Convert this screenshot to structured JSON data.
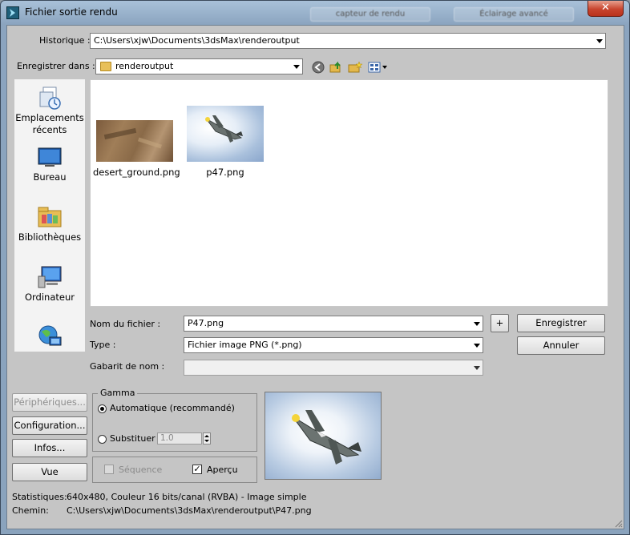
{
  "window": {
    "title": "Fichier sortie rendu",
    "close_glyph": "✕",
    "background_tabs": [
      "capteur de rendu",
      "Éclairage avancé"
    ]
  },
  "historique": {
    "label": "Historique :",
    "value": "C:\\Users\\xjw\\Documents\\3dsMax\\renderoutput"
  },
  "save_in": {
    "label": "Enregistrer dans :",
    "value": "renderoutput",
    "tools": [
      "back-icon",
      "up-folder-icon",
      "new-folder-icon",
      "view-menu-icon"
    ]
  },
  "places": [
    {
      "label": "Emplacements récents",
      "icon": "recent-places-icon"
    },
    {
      "label": "Bureau",
      "icon": "desktop-icon"
    },
    {
      "label": "Bibliothèques",
      "icon": "libraries-icon"
    },
    {
      "label": "Ordinateur",
      "icon": "computer-icon"
    },
    {
      "label": "",
      "icon": "network-icon"
    }
  ],
  "files": [
    {
      "name": "desert_ground.png"
    },
    {
      "name": "p47.png"
    }
  ],
  "filename": {
    "label": "Nom du fichier :",
    "value": "P47.png"
  },
  "type": {
    "label": "Type :",
    "value": "Fichier image PNG (*.png)"
  },
  "gabarit": {
    "label": "Gabarit de nom :",
    "value": ""
  },
  "buttons": {
    "plus": "+",
    "save": "Enregistrer",
    "cancel": "Annuler",
    "devices": "Périphériques...",
    "setup": "Configuration...",
    "info": "Infos...",
    "view": "Vue"
  },
  "gamma": {
    "title": "Gamma",
    "auto_label": "Automatique (recommandé)",
    "override_label": "Substituer",
    "override_value": "1.0",
    "selected": "auto"
  },
  "options": {
    "sequence_label": "Séquence",
    "sequence_checked": false,
    "preview_label": "Aperçu",
    "preview_checked": true
  },
  "stats": {
    "label": "Statistiques:",
    "value": "640x480, Couleur 16 bits/canal (RVBA) - Image simple"
  },
  "path": {
    "label": "Chemin:",
    "value": "C:\\Users\\xjw\\Documents\\3dsMax\\renderoutput\\P47.png"
  },
  "colors": {
    "dialog_bg": "#c5c5c5",
    "titlebar": "#9fb8d2",
    "close_button": "#c8452e",
    "list_bg": "#ffffff"
  }
}
